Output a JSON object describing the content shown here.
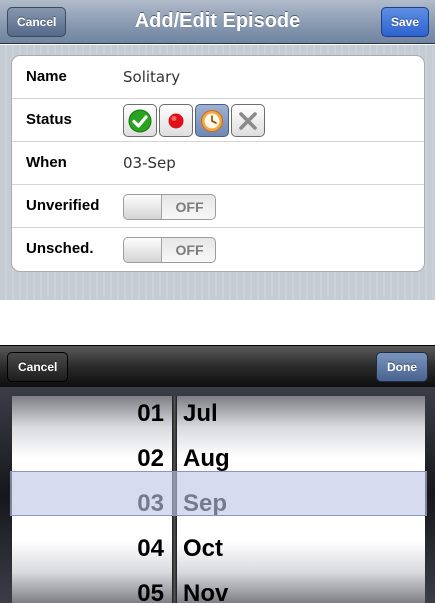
{
  "nav": {
    "title": "Add/Edit Episode",
    "cancel_label": "Cancel",
    "save_label": "Save"
  },
  "form": {
    "name": {
      "label": "Name",
      "value": "Solitary"
    },
    "status": {
      "label": "Status",
      "options": [
        {
          "icon": "checkmark-icon",
          "color": "#1f9a17"
        },
        {
          "icon": "red-dot-icon",
          "color": "#e0101a"
        },
        {
          "icon": "clock-icon",
          "color": "#f39a2a",
          "selected": true
        },
        {
          "icon": "x-icon",
          "color": "#8a8a8a"
        }
      ]
    },
    "when": {
      "label": "When",
      "value": "03-Sep"
    },
    "unverified": {
      "label": "Unverified",
      "toggle": "OFF"
    },
    "unsched": {
      "label": "Unsched.",
      "toggle": "OFF"
    }
  },
  "picker_toolbar": {
    "cancel_label": "Cancel",
    "done_label": "Done"
  },
  "picker": {
    "days": [
      "01",
      "02",
      "03",
      "04",
      "05"
    ],
    "months": [
      "Jul",
      "Aug",
      "Sep",
      "Oct",
      "Nov"
    ],
    "selected_day": "03",
    "selected_month": "Sep"
  }
}
